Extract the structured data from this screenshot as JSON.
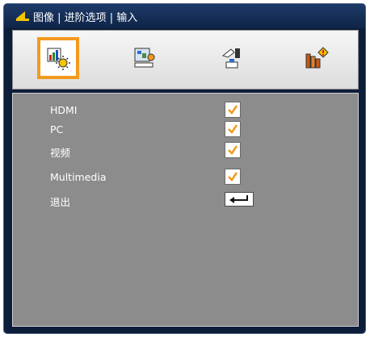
{
  "window": {
    "title": "图像 | 进阶选项 | 输入"
  },
  "tabs": [
    {
      "icon": "image-settings-icon",
      "selected": true
    },
    {
      "icon": "display-settings-icon",
      "selected": false
    },
    {
      "icon": "setup-icon",
      "selected": false
    },
    {
      "icon": "options-info-icon",
      "selected": false
    }
  ],
  "menu": {
    "items": [
      {
        "label": "HDMI",
        "checked": true
      },
      {
        "label": "PC",
        "checked": true
      },
      {
        "label": "视频",
        "checked": true
      },
      {
        "label": "Multimedia",
        "checked": true
      }
    ],
    "exit_label": "退出"
  },
  "colors": {
    "accent": "#f39a1e",
    "panel": "#8c8c8c",
    "titlebar": "#1d3a68"
  }
}
